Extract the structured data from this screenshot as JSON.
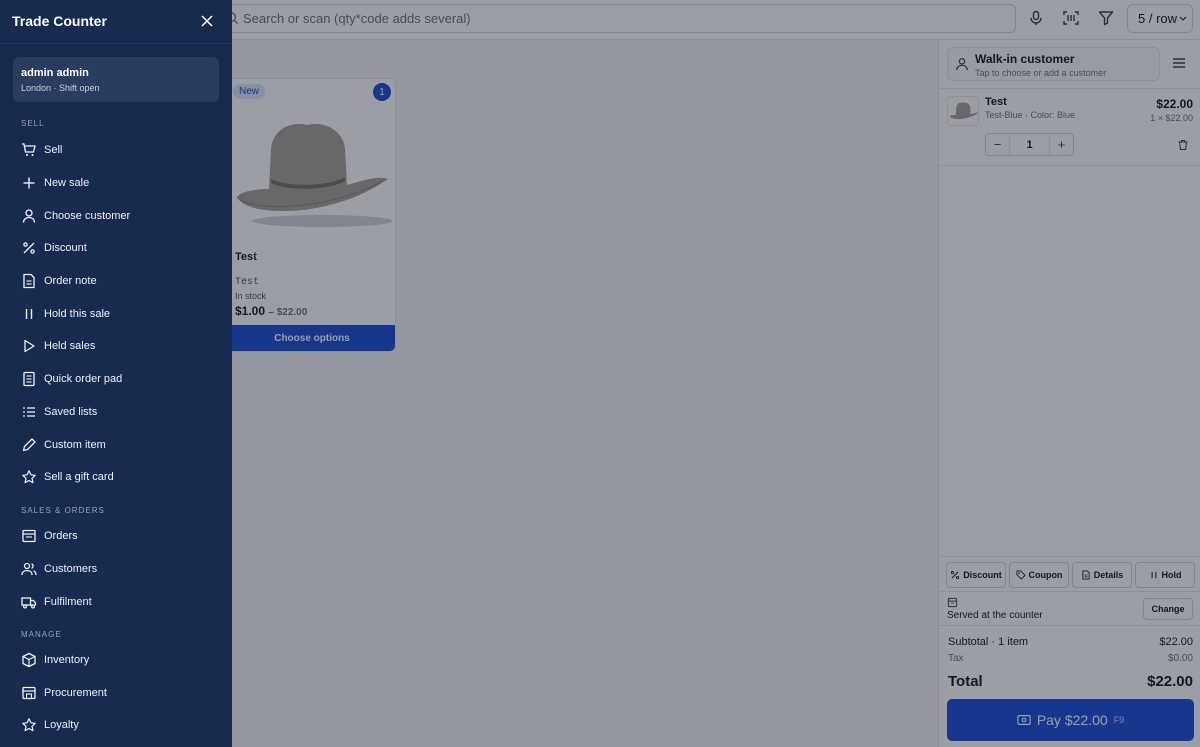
{
  "topbar": {
    "search_placeholder": "Search or scan (qty*code adds several)",
    "rows_per_row": "5 / row"
  },
  "product": {
    "badge": "New",
    "cart_count": "1",
    "name": "Test",
    "sku": "Test",
    "stock": "In stock",
    "price": "$1.00",
    "price_range": "– $22.00",
    "cta": "Choose options"
  },
  "cart": {
    "customer_name": "Walk-in customer",
    "customer_hint": "Tap to choose or add a customer",
    "line": {
      "name": "Test",
      "variant": "Test-Blue · Color: Blue",
      "price": "$22.00",
      "unit": "1 × $22.00",
      "qty": "1"
    },
    "actions": {
      "discount": "Discount",
      "coupon": "Coupon",
      "details": "Details",
      "hold": "Hold"
    },
    "served": "Served at the counter",
    "change": "Change",
    "subtotal_label": "Subtotal · 1 item",
    "subtotal_value": "$22.00",
    "tax_label": "Tax",
    "tax_value": "$0.00",
    "total_label": "Total",
    "total_value": "$22.00",
    "pay_label": "Pay $22.00",
    "pay_key": "F9"
  },
  "drawer": {
    "title": "Trade Counter",
    "user_name": "admin admin",
    "user_status": "London · Shift open",
    "sections": {
      "sell": "SELL",
      "sales_orders": "SALES & ORDERS",
      "manage": "MANAGE"
    },
    "items": {
      "sell": "Sell",
      "new_sale": "New sale",
      "choose_customer": "Choose customer",
      "discount": "Discount",
      "order_note": "Order note",
      "hold_sale": "Hold this sale",
      "held_sales": "Held sales",
      "quick_order_pad": "Quick order pad",
      "saved_lists": "Saved lists",
      "custom_item": "Custom item",
      "gift_card": "Sell a gift card",
      "orders": "Orders",
      "customers": "Customers",
      "fulfilment": "Fulfilment",
      "inventory": "Inventory",
      "procurement": "Procurement",
      "loyalty": "Loyalty"
    }
  },
  "colors": {
    "drawer_bg": "#172a4f",
    "accent": "#1d4ed8"
  }
}
